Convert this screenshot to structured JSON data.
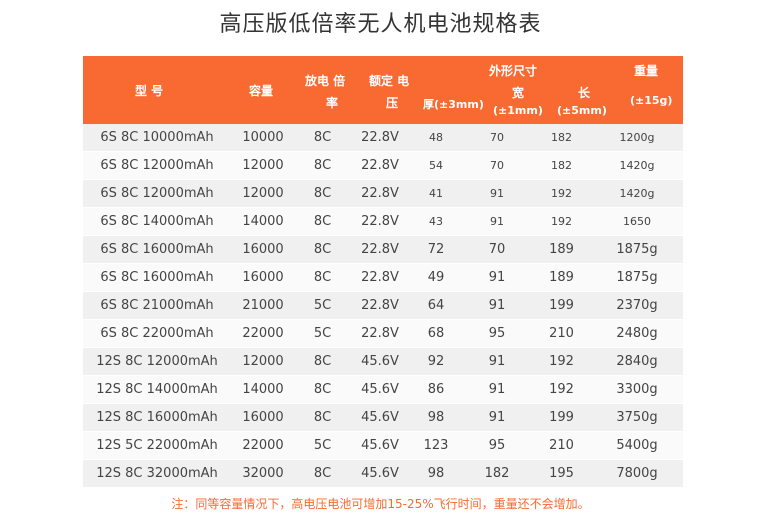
{
  "title": "高压版低倍率无人机电池规格表",
  "header": {
    "model": "型    号",
    "capacity": "容量",
    "discharge_rate_1": "放电  倍",
    "discharge_rate_2": "率",
    "voltage_1": "额定  电",
    "voltage_2": "压",
    "dimensions": "外形尺寸",
    "thickness": "厚(±3mm)",
    "width_1": "宽",
    "width_2": "(±1mm)",
    "length_1": "长",
    "length_2": "(±5mm)",
    "weight_1": "重量",
    "weight_2": "(±15g)"
  },
  "rows": [
    {
      "model": "6S 8C 10000mAh",
      "capacity": "10000",
      "rate": "8C",
      "voltage": "22.8V",
      "thickness": "48",
      "width": "70",
      "length": "182",
      "weight": "1200g"
    },
    {
      "model": "6S 8C 12000mAh",
      "capacity": "12000",
      "rate": "8C",
      "voltage": "22.8V",
      "thickness": "54",
      "width": "70",
      "length": "182",
      "weight": "1420g"
    },
    {
      "model": "6S 8C 12000mAh",
      "capacity": "12000",
      "rate": "8C",
      "voltage": "22.8V",
      "thickness": "41",
      "width": "91",
      "length": "192",
      "weight": "1420g"
    },
    {
      "model": "6S 8C 14000mAh",
      "capacity": "14000",
      "rate": "8C",
      "voltage": "22.8V",
      "thickness": "43",
      "width": "91",
      "length": "192",
      "weight": "1650"
    },
    {
      "model": "6S 8C 16000mAh",
      "capacity": "16000",
      "rate": "8C",
      "voltage": "22.8V",
      "thickness": "72",
      "width": "70",
      "length": "189",
      "weight": "1875g"
    },
    {
      "model": "6S 8C 16000mAh",
      "capacity": "16000",
      "rate": "8C",
      "voltage": "22.8V",
      "thickness": "49",
      "width": "91",
      "length": "189",
      "weight": "1875g"
    },
    {
      "model": "6S 8C 21000mAh",
      "capacity": "21000",
      "rate": "5C",
      "voltage": "22.8V",
      "thickness": "64",
      "width": "91",
      "length": "199",
      "weight": "2370g"
    },
    {
      "model": "6S 8C 22000mAh",
      "capacity": "22000",
      "rate": "5C",
      "voltage": "22.8V",
      "thickness": "68",
      "width": "95",
      "length": "210",
      "weight": "2480g"
    },
    {
      "model": "12S 8C 12000mAh",
      "capacity": "12000",
      "rate": "8C",
      "voltage": "45.6V",
      "thickness": "92",
      "width": "91",
      "length": "192",
      "weight": "2840g"
    },
    {
      "model": "12S 8C 14000mAh",
      "capacity": "14000",
      "rate": "8C",
      "voltage": "45.6V",
      "thickness": "86",
      "width": "91",
      "length": "192",
      "weight": "3300g"
    },
    {
      "model": "12S 8C 16000mAh",
      "capacity": "16000",
      "rate": "8C",
      "voltage": "45.6V",
      "thickness": "98",
      "width": "91",
      "length": "199",
      "weight": "3750g"
    },
    {
      "model": "12S 5C 22000mAh",
      "capacity": "22000",
      "rate": "5C",
      "voltage": "45.6V",
      "thickness": "123",
      "width": "95",
      "length": "210",
      "weight": "5400g"
    },
    {
      "model": "12S 8C 32000mAh",
      "capacity": "32000",
      "rate": "8C",
      "voltage": "45.6V",
      "thickness": "98",
      "width": "182",
      "length": "195",
      "weight": "7800g"
    }
  ],
  "note": "注：同等容量情况下，高电压电池可增加15-25%飞行时间，重量还不会增加。",
  "colors": {
    "header_bg": "#f96a33",
    "note": "#f96a33"
  }
}
